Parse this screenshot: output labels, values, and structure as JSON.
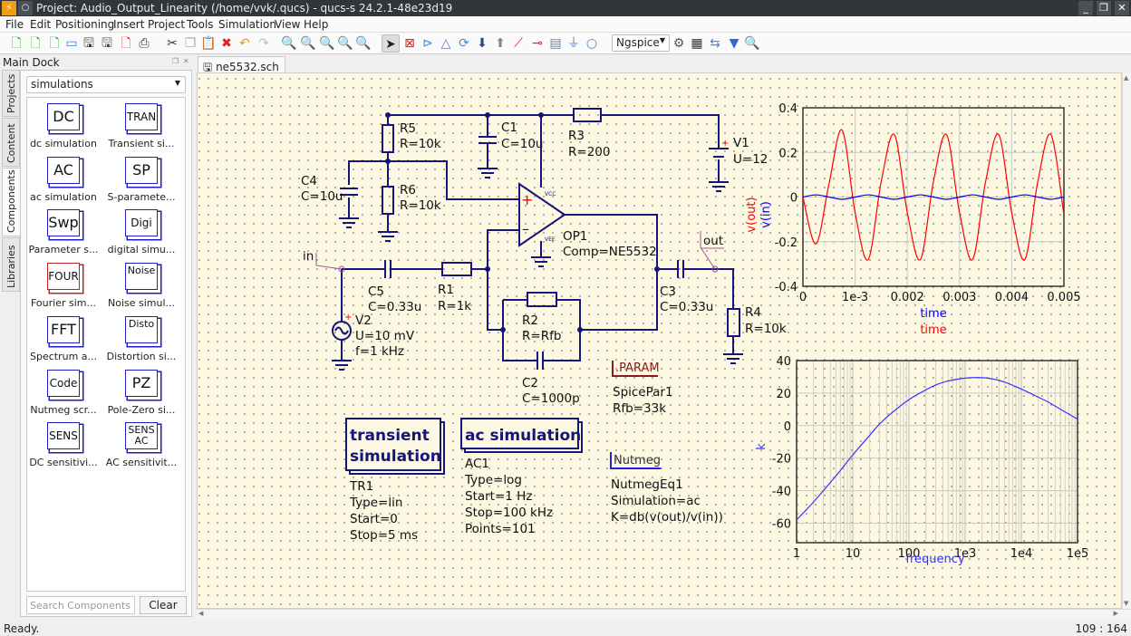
{
  "window": {
    "title": "Project: Audio_Output_Linearity (/home/vvk/.qucs) - qucs-s 24.2.1-48e23d19",
    "controls": [
      "minimize",
      "maximize",
      "close"
    ]
  },
  "menu": [
    "File",
    "Edit",
    "Positioning",
    "Insert",
    "Project",
    "Tools",
    "Simulation",
    "View",
    "Help"
  ],
  "toolbar": {
    "icons": [
      "new-schematic-icon",
      "new-text-icon",
      "new-project-icon",
      "open-icon",
      "save-icon",
      "save-all-icon",
      "close-file-icon",
      "print-icon",
      "cut-icon",
      "copy-icon",
      "paste-icon",
      "delete-icon",
      "undo-icon",
      "redo-icon",
      "zoom-fit-icon",
      "zoom-selection-icon",
      "zoom-1-1-icon",
      "zoom-in-icon",
      "zoom-out-icon",
      "select-icon",
      "deactivate-icon",
      "mirror-x-icon",
      "mirror-y-icon",
      "rotate-icon",
      "go-into-subcircuit-icon",
      "pop-out-icon",
      "wire-icon",
      "wire-label-icon",
      "equation-icon",
      "ground-icon",
      "port-icon",
      "simulator-settings-icon",
      "simulate-icon",
      "view-data-display-icon",
      "marker-icon",
      "tune-icon"
    ],
    "simulator": "Ngspice"
  },
  "dock": {
    "title": "Main Dock",
    "tabs": [
      "Projects",
      "Content",
      "Components",
      "Libraries"
    ],
    "active_tab": "Components",
    "category": "simulations",
    "components": [
      {
        "icon": "DC",
        "label": "dc simulation"
      },
      {
        "icon": "TRAN",
        "label": "Transient si..."
      },
      {
        "icon": "AC",
        "label": "ac simulation"
      },
      {
        "icon": "SP",
        "label": "S-paramete..."
      },
      {
        "icon": "Swp",
        "label": "Parameter s..."
      },
      {
        "icon": "Digi",
        "label": "digital simu..."
      },
      {
        "icon": "FOUR",
        "label": "Fourier sim..."
      },
      {
        "icon": "Noise",
        "label": "Noise simul..."
      },
      {
        "icon": "FFT",
        "label": "Spectrum a..."
      },
      {
        "icon": "Disto",
        "label": "Distortion si..."
      },
      {
        "icon": "Code",
        "label": "Nutmeg scr..."
      },
      {
        "icon": "PZ",
        "label": "Pole-Zero si..."
      },
      {
        "icon": "SENS",
        "label": "DC sensitivi..."
      },
      {
        "icon": "SENS AC",
        "label": "AC sensitivit..."
      }
    ],
    "search_placeholder": "Search Components",
    "clear_label": "Clear"
  },
  "document_tab": "ne5532.sch",
  "schematic": {
    "R5": [
      "R5",
      "R=10k"
    ],
    "R6": [
      "R6",
      "R=10k"
    ],
    "C4": [
      "C4",
      "C=10u"
    ],
    "C1": [
      "C1",
      "C=10u"
    ],
    "R3": [
      "R3",
      "R=200"
    ],
    "V1": [
      "V1",
      "U=12"
    ],
    "OP1": [
      "OP1",
      "Comp=NE5532"
    ],
    "op_pins": [
      "VCC",
      "VEE"
    ],
    "C5": [
      "C5",
      "C=0.33u"
    ],
    "R1": [
      "R1",
      "R=1k"
    ],
    "V2": [
      "V2",
      "U=10 mV",
      "f=1 kHz"
    ],
    "R2": [
      "R2",
      "R=Rfb"
    ],
    "C2": [
      "C2",
      "C=1000p"
    ],
    "C3": [
      "C3",
      "C=0.33u"
    ],
    "R4": [
      "R4",
      "R=10k"
    ],
    "label_in": "in",
    "label_out": "out",
    "param": {
      "header": ".PARAM",
      "lines": [
        "SpicePar1",
        "Rfb=33k"
      ]
    },
    "tran": {
      "title": [
        "transient",
        "simulation"
      ],
      "lines": [
        "TR1",
        "Type=lin",
        "Start=0",
        "Stop=5 ms"
      ]
    },
    "ac": {
      "title": "ac simulation",
      "lines": [
        "AC1",
        "Type=log",
        "Start=1 Hz",
        "Stop=100 kHz",
        "Points=101"
      ]
    },
    "nutmeg": {
      "header": "Nutmeg",
      "lines": [
        "NutmegEq1",
        "Simulation=ac",
        "K=db(v(out)/v(in))"
      ]
    }
  },
  "chart_data": [
    {
      "type": "line",
      "x": [
        0,
        0.00025,
        0.0005,
        0.00075,
        0.001,
        0.00125,
        0.0015,
        0.00175,
        0.002,
        0.00225,
        0.0025,
        0.00275,
        0.003,
        0.00325,
        0.0035,
        0.00375,
        0.004,
        0.00425,
        0.0045,
        0.00475,
        0.005
      ],
      "series": [
        {
          "name": "v(out)",
          "color": "#ff0000",
          "values": [
            0,
            -0.21,
            0.06,
            0.3,
            -0.07,
            -0.28,
            0.07,
            0.28,
            -0.07,
            -0.28,
            0.07,
            0.28,
            -0.07,
            -0.28,
            0.07,
            0.28,
            -0.07,
            -0.28,
            0.07,
            0.28,
            -0.08
          ]
        },
        {
          "name": "v(in)",
          "color": "#0000ff",
          "values": [
            0,
            0.01,
            0,
            -0.01,
            0,
            0.01,
            0,
            -0.01,
            0,
            0.01,
            0,
            -0.01,
            0,
            0.01,
            0,
            -0.01,
            0,
            0.01,
            0,
            -0.01,
            0
          ]
        }
      ],
      "xlabels": [
        {
          "text": "time",
          "color": "#0000ff"
        },
        {
          "text": "time",
          "color": "#ff0000"
        }
      ],
      "xlim": [
        0,
        0.005
      ],
      "ylim": [
        -0.4,
        0.4
      ],
      "xticks": [
        "0",
        "1e-3",
        "0.002",
        "0.003",
        "0.004",
        "0.005"
      ],
      "yticks": [
        "-0.4",
        "-0.2",
        "0",
        "0.2",
        "0.4"
      ],
      "grid": true
    },
    {
      "type": "line",
      "xscale": "log",
      "x": [
        1,
        2,
        5,
        10,
        20,
        30,
        50,
        100,
        200,
        300,
        500,
        1000,
        2000,
        3000,
        5000,
        10000,
        20000,
        30000,
        50000,
        100000
      ],
      "series": [
        {
          "name": "k",
          "color": "#3333ff",
          "values": [
            -58,
            -47,
            -31,
            -18,
            -6,
            1,
            8,
            16,
            22,
            25,
            27.5,
            29.2,
            29.5,
            28.8,
            26.8,
            22.5,
            17.5,
            14.5,
            10,
            4
          ]
        }
      ],
      "xlabel": "frequency",
      "ylabel": "k",
      "xlim": [
        1,
        100000
      ],
      "ylim": [
        -72,
        40
      ],
      "xticks": [
        "1",
        "10",
        "100",
        "1e3",
        "1e4",
        "1e5"
      ],
      "yticks": [
        "-60",
        "-40",
        "-20",
        "0",
        "20",
        "40"
      ],
      "grid": true
    }
  ],
  "status": {
    "text": "Ready.",
    "coords": "109 : 164"
  }
}
